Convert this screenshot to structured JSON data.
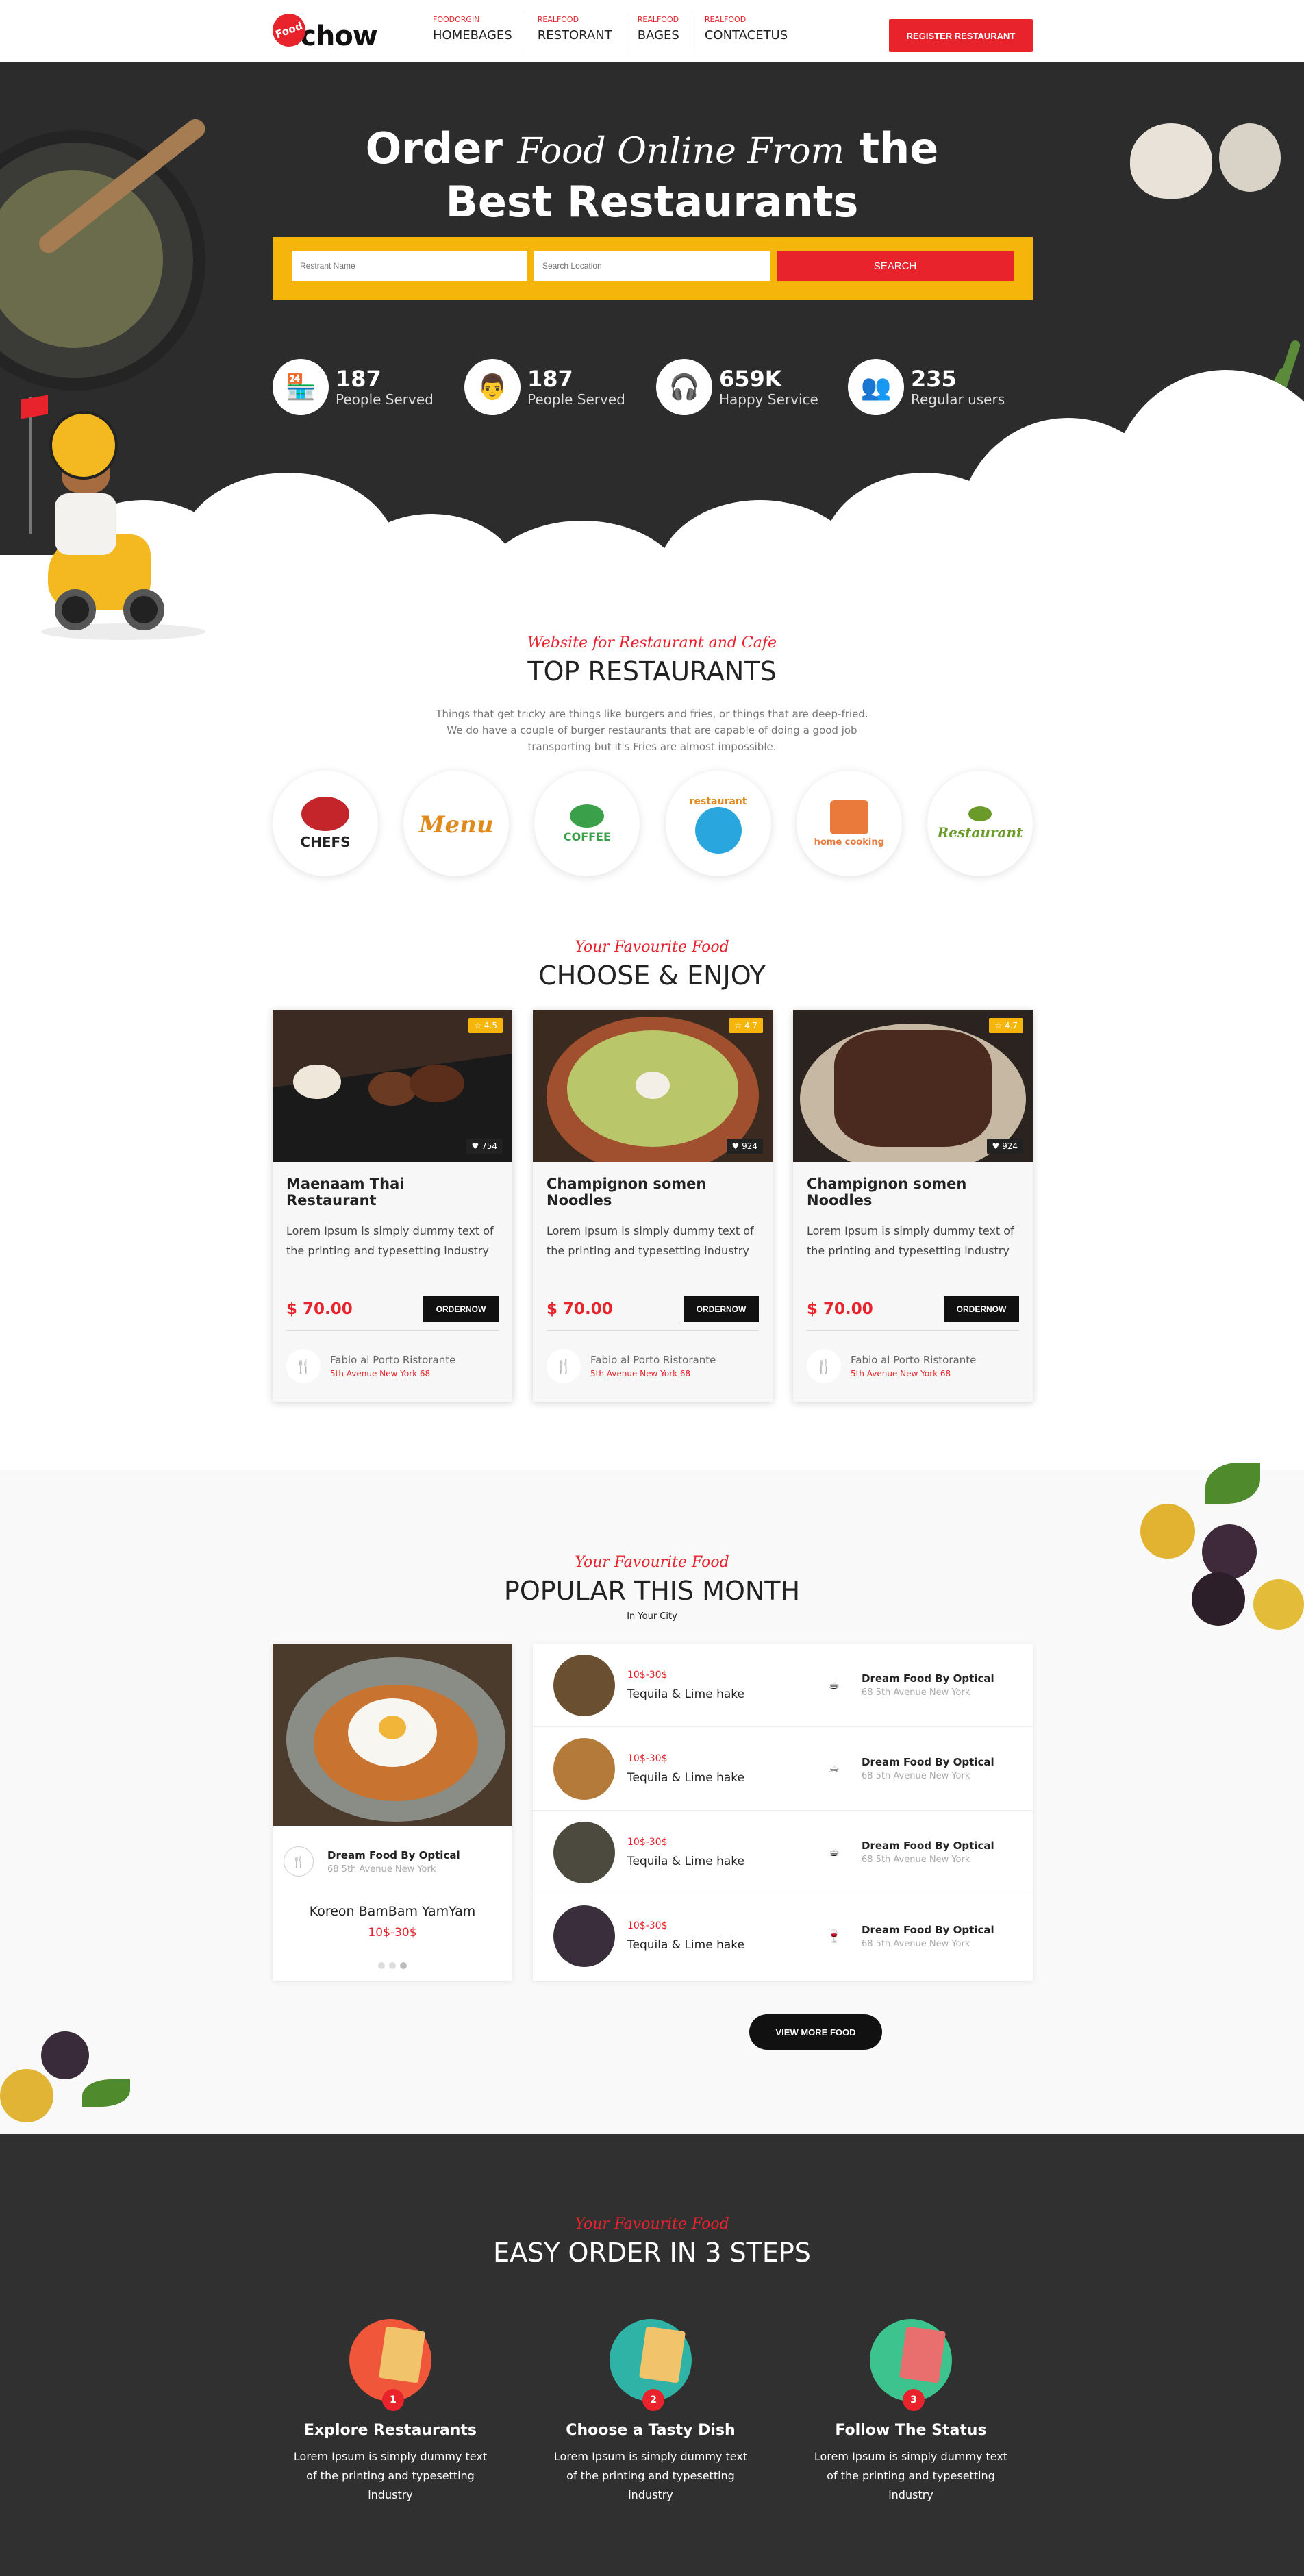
{
  "header": {
    "logo_badge": "Food",
    "logo_name_a": ".",
    "logo_name_b": "chow",
    "nav": [
      {
        "sub": "FOODORGIN",
        "label": "HOMEBAGES"
      },
      {
        "sub": "REALFOOD",
        "label": "RESTORANT"
      },
      {
        "sub": "REALFOOD",
        "label": "BAGES"
      },
      {
        "sub": "REALFOOD",
        "label": "CONTACETUS"
      }
    ],
    "register_label": "REGISTER RESTAURANT"
  },
  "hero": {
    "title_a": "Order",
    "title_script": "Food Online From",
    "title_b": "the",
    "title_line2": "Best Restaurants",
    "search": {
      "restaurant_placeholder": "Restrant Name",
      "location_placeholder": "Search Location",
      "button_label": "SEARCH"
    },
    "stats": [
      {
        "num": "187",
        "label": "People Served",
        "icon": "store-icon"
      },
      {
        "num": "187",
        "label": "People Served",
        "icon": "chef-icon"
      },
      {
        "num": "659K",
        "label": "Happy Service",
        "icon": "support-icon"
      },
      {
        "num": "235",
        "label": "Regular users",
        "icon": "users-icon"
      }
    ]
  },
  "top_restaurants": {
    "script": "Website for Restaurant and Cafe",
    "title": "TOP RESTAURANTS",
    "desc": "Things that get tricky are things like burgers and fries, or things that are deep-fried. We do have a couple of burger restaurants that are capable of doing a good job transporting but it's Fries are almost impossible.",
    "logos": [
      {
        "label": "CHEFS",
        "color": "#c3252b"
      },
      {
        "label": "Menu",
        "color": "#e08a1e"
      },
      {
        "label": "COFFEE",
        "color": "#3aa14a"
      },
      {
        "label": "restaurant",
        "color": "#2aa6df"
      },
      {
        "label": "home cooking",
        "color": "#ea7a3b"
      },
      {
        "label": "Restaurant",
        "color": "#6a9a2a"
      }
    ]
  },
  "choose": {
    "script": "Your Favourite Food",
    "title": "CHOOSE & ENJOY",
    "cards": [
      {
        "rating": "☆ 4.5",
        "likes": "♥ 754",
        "title": "Maenaam Thai Restaurant",
        "desc": "Lorem Ipsum is simply dummy text of the printing and typesetting industry",
        "price": "$ 70.00",
        "order": "ORDERNOW",
        "rest_name": "Fabio al Porto Ristorante",
        "rest_addr": "5th Avenue New York 68"
      },
      {
        "rating": "☆ 4.7",
        "likes": "♥ 924",
        "title": "Champignon somen Noodles",
        "desc": "Lorem Ipsum is simply dummy text of the printing and typesetting industry",
        "price": "$ 70.00",
        "order": "ORDERNOW",
        "rest_name": "Fabio al Porto Ristorante",
        "rest_addr": "5th Avenue New York 68"
      },
      {
        "rating": "☆ 4.7",
        "likes": "♥ 924",
        "title": "Champignon somen Noodles",
        "desc": "Lorem Ipsum is simply dummy text of the printing and typesetting industry",
        "price": "$ 70.00",
        "order": "ORDERNOW",
        "rest_name": "Fabio al Porto Ristorante",
        "rest_addr": "5th Avenue New York 68"
      }
    ]
  },
  "popular": {
    "script": "Your Favourite Food",
    "title": "POPULAR THIS MONTH",
    "subtitle": "In Your City",
    "featured": {
      "rest_name": "Dream Food By Optical",
      "rest_addr": "68 5th Avenue New York",
      "dish": "Koreon BamBam YamYam",
      "price": "10$-30$"
    },
    "items": [
      {
        "price": "10$-30$",
        "dish": "Tequila & Lime hake",
        "rest_name": "Dream Food By Optical",
        "rest_addr": "68 5th Avenue New York"
      },
      {
        "price": "10$-30$",
        "dish": "Tequila & Lime hake",
        "rest_name": "Dream Food By Optical",
        "rest_addr": "68 5th Avenue New York"
      },
      {
        "price": "10$-30$",
        "dish": "Tequila & Lime hake",
        "rest_name": "Dream Food By Optical",
        "rest_addr": "68 5th Avenue New York"
      },
      {
        "price": "10$-30$",
        "dish": "Tequila & Lime hake",
        "rest_name": "Dream Food By Optical",
        "rest_addr": "68 5th Avenue New York"
      }
    ],
    "view_more": "VIEW MORE FOOD"
  },
  "steps": {
    "script": "Your Favourite Food",
    "title": "EASY ORDER IN 3 STEPS",
    "items": [
      {
        "num": "1",
        "title": "Explore Restaurants",
        "desc": "Lorem Ipsum is simply dummy text of the printing and typesetting industry",
        "color": "#f0573a"
      },
      {
        "num": "2",
        "title": "Choose a Tasty Dish",
        "desc": "Lorem Ipsum is simply dummy text of the printing and typesetting industry",
        "color": "#2fb3a6"
      },
      {
        "num": "3",
        "title": "Follow The Status",
        "desc": "Lorem Ipsum is simply dummy text of the printing and typesetting industry",
        "color": "#3cc38e"
      }
    ]
  },
  "colors": {
    "accent": "#e8232c",
    "yellow": "#f5b50a",
    "dark": "#303030"
  }
}
